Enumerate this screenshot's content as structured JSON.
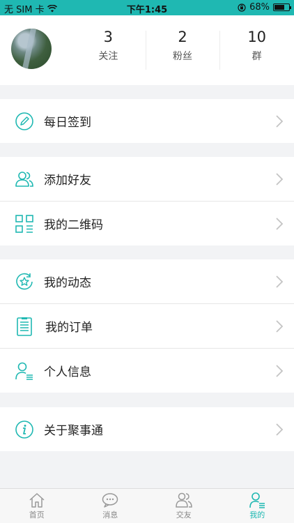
{
  "status_bar": {
    "carrier": "无 SIM 卡",
    "time": "下午1:45",
    "battery": "68%",
    "battery_level": 0.68
  },
  "profile": {
    "stats": [
      {
        "value": "3",
        "label": "关注"
      },
      {
        "value": "2",
        "label": "粉丝"
      },
      {
        "value": "10",
        "label": "群"
      }
    ]
  },
  "menu": {
    "checkin": "每日签到",
    "add_friend": "添加好友",
    "qr_code": "我的二维码",
    "moments": "我的动态",
    "orders": "我的订单",
    "personal_info": "个人信息",
    "about": "关于聚事通"
  },
  "tabs": [
    {
      "label": "首页",
      "icon": "home-icon"
    },
    {
      "label": "消息",
      "icon": "message-icon"
    },
    {
      "label": "交友",
      "icon": "friends-icon"
    },
    {
      "label": "我的",
      "icon": "profile-icon",
      "active": true
    }
  ],
  "colors": {
    "accent": "#1fb8b2",
    "background": "#f2f3f5"
  }
}
